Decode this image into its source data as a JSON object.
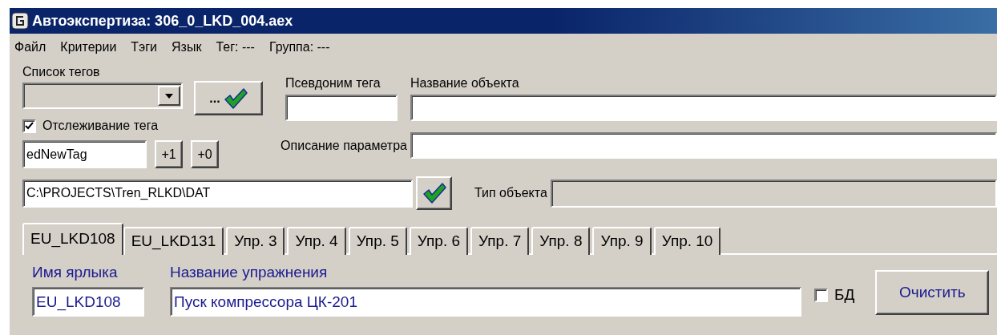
{
  "window": {
    "title": "Автоэкспертиза: 306_0_LKD_004.aex"
  },
  "menu": [
    "Файл",
    "Критерии",
    "Тэги",
    "Язык",
    "Тег: ---",
    "Группа: ---"
  ],
  "tag_list": {
    "label": "Список тегов",
    "disabled": true,
    "browse_button": "..."
  },
  "tracking": {
    "label": "Отслеживание тега",
    "checked": true
  },
  "new_tag": {
    "value": "edNewTag",
    "buttons": [
      "+1",
      "+0"
    ]
  },
  "alias": {
    "label": "Псевдоним тега"
  },
  "object_name": {
    "label": "Название объекта"
  },
  "param_description": {
    "label": "Описание параметра"
  },
  "path": {
    "value": "C:\\PROJECTS\\Tren_RLKD\\DAT"
  },
  "object_type": {
    "label": "Тип объекта",
    "disabled": true
  },
  "tabs": [
    {
      "label": "EU_LKD108",
      "selected": true
    },
    {
      "label": "EU_LKD131",
      "selected": false
    },
    {
      "label": "Упр. 3",
      "selected": false
    },
    {
      "label": "Упр. 4",
      "selected": false
    },
    {
      "label": "Упр. 5",
      "selected": false
    },
    {
      "label": "Упр. 6",
      "selected": false
    },
    {
      "label": "Упр. 7",
      "selected": false
    },
    {
      "label": "Упр. 8",
      "selected": false
    },
    {
      "label": "Упр. 9",
      "selected": false
    },
    {
      "label": "Упр. 10",
      "selected": false
    }
  ],
  "panel": {
    "shortcut": {
      "label": "Имя ярлыка",
      "value": "EU_LKD108"
    },
    "exercise": {
      "label": "Название упражнения",
      "value": "Пуск компрессора ЦК-201"
    },
    "db": {
      "label": "БД",
      "checked": false
    },
    "clear_button": "Очистить"
  }
}
